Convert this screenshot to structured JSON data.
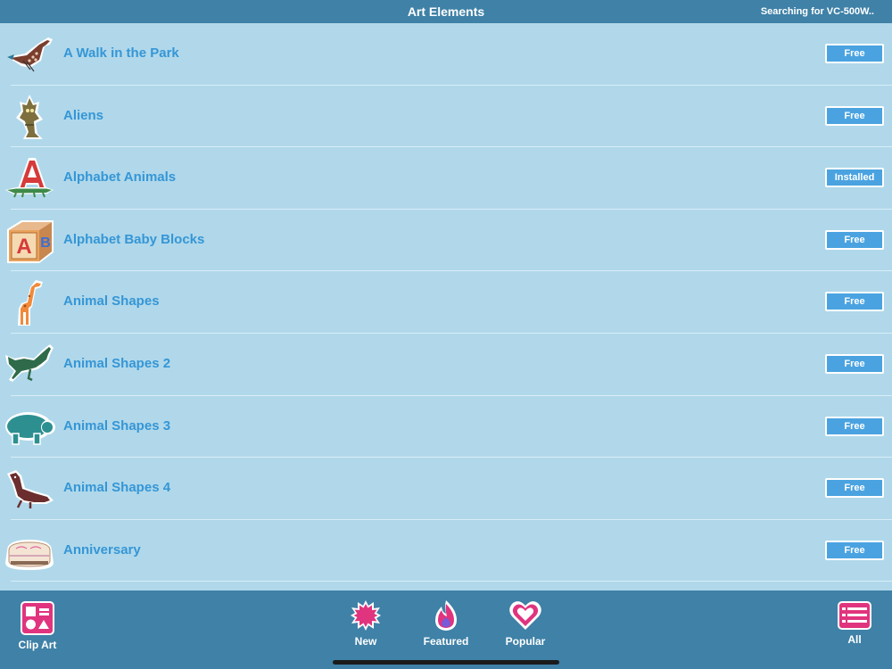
{
  "header": {
    "title": "Art Elements",
    "status": "Searching for VC-500W.."
  },
  "items": [
    {
      "name": "A Walk in the Park",
      "badge": "Free",
      "icon": "bird-icon"
    },
    {
      "name": "Aliens",
      "badge": "Free",
      "icon": "alien-icon"
    },
    {
      "name": "Alphabet Animals",
      "badge": "Installed",
      "icon": "letter-a-alligator-icon"
    },
    {
      "name": "Alphabet Baby Blocks",
      "badge": "Free",
      "icon": "baby-block-icon"
    },
    {
      "name": "Animal Shapes",
      "badge": "Free",
      "icon": "giraffe-icon"
    },
    {
      "name": "Animal Shapes 2",
      "badge": "Free",
      "icon": "horse-icon"
    },
    {
      "name": "Animal Shapes 3",
      "badge": "Free",
      "icon": "hippo-icon"
    },
    {
      "name": "Animal Shapes 4",
      "badge": "Free",
      "icon": "otter-icon"
    },
    {
      "name": "Anniversary",
      "badge": "Free",
      "icon": "anniversary-cake-icon"
    }
  ],
  "tabs": {
    "clipart": {
      "label": "Clip Art",
      "icon": "clip-art-icon"
    },
    "new": {
      "label": "New",
      "icon": "burst-icon"
    },
    "featured": {
      "label": "Featured",
      "icon": "flame-icon"
    },
    "popular": {
      "label": "Popular",
      "icon": "heart-icon"
    },
    "all": {
      "label": "All",
      "icon": "list-icon"
    }
  },
  "colors": {
    "bar": "#3f81a7",
    "background": "#b0d8ea",
    "item_text": "#3596d6",
    "badge": "#4aa3e0",
    "tab_icon": "#e0347e"
  }
}
